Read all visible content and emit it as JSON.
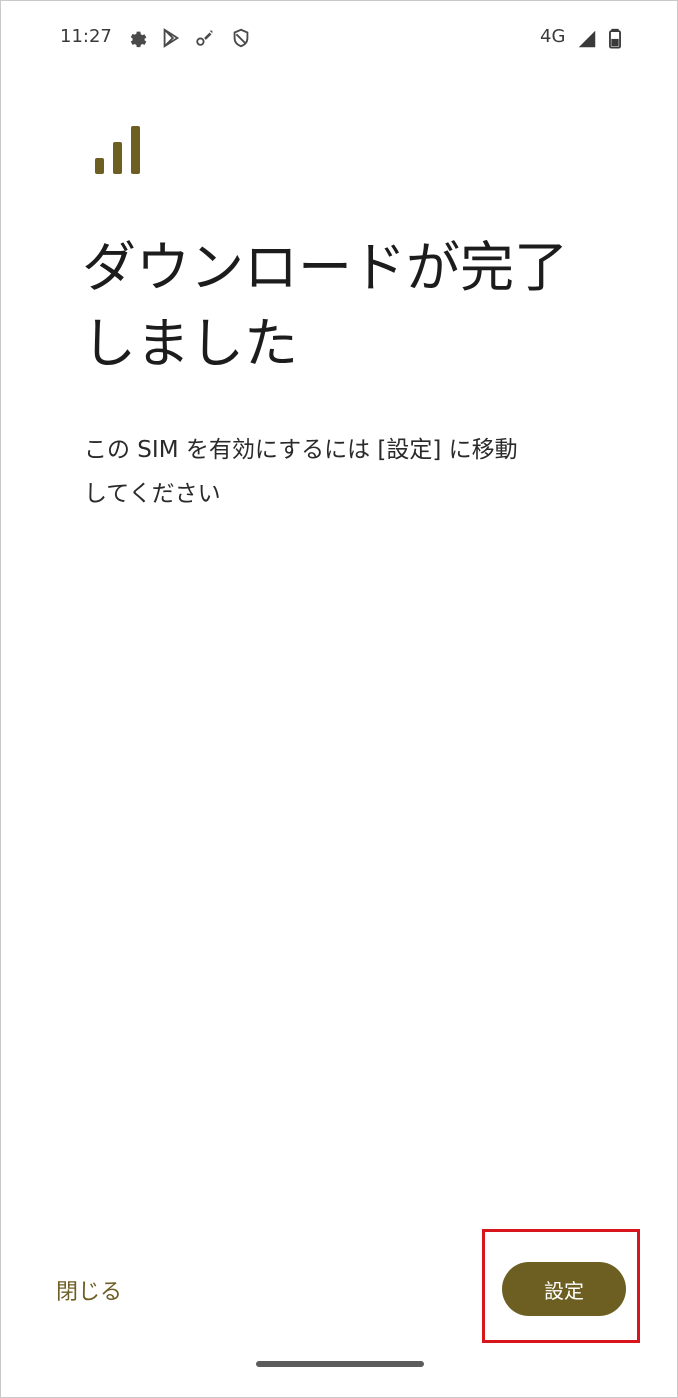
{
  "status_bar": {
    "time": "11:27",
    "icons": [
      "settings-icon",
      "play-store-icon",
      "wrench-icon",
      "shield-icon"
    ],
    "network": "4G",
    "right_icons": [
      "cellular-signal-icon",
      "battery-icon"
    ]
  },
  "content": {
    "icon": "signal-bars-icon",
    "title_line1": "ダウンロードが完了",
    "title_line2": "しました",
    "description_line1": "この SIM を有効にするには [設定] に移動",
    "description_line2": "してください"
  },
  "actions": {
    "close_label": "閉じる",
    "settings_label": "設定"
  },
  "colors": {
    "accent": "#6d5f22",
    "highlight": "#d8141c",
    "background": "#ffffff"
  }
}
